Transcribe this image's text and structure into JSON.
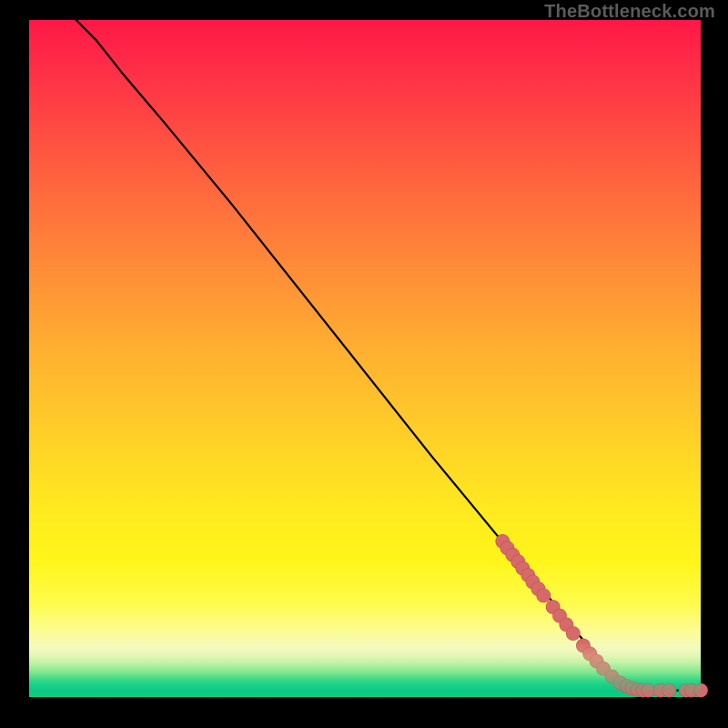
{
  "watermark": "TheBottleneck.com",
  "colors": {
    "marker_fill": "#d66a6a",
    "marker_stroke": "#c25858",
    "line": "#000000",
    "frame": "#000000"
  },
  "chart_data": {
    "type": "line",
    "title": "",
    "xlabel": "",
    "ylabel": "",
    "xlim": [
      0,
      100
    ],
    "ylim": [
      0,
      100
    ],
    "grid": false,
    "legend": false,
    "curve": [
      {
        "x": 7,
        "y": 100
      },
      {
        "x": 8,
        "y": 99
      },
      {
        "x": 10,
        "y": 97
      },
      {
        "x": 12,
        "y": 94.5
      },
      {
        "x": 14,
        "y": 92
      },
      {
        "x": 17,
        "y": 88.5
      },
      {
        "x": 20,
        "y": 85
      },
      {
        "x": 30,
        "y": 73
      },
      {
        "x": 40,
        "y": 60.5
      },
      {
        "x": 50,
        "y": 48
      },
      {
        "x": 60,
        "y": 35.5
      },
      {
        "x": 70,
        "y": 23.5
      },
      {
        "x": 78,
        "y": 14
      },
      {
        "x": 82,
        "y": 9
      },
      {
        "x": 85,
        "y": 5.5
      },
      {
        "x": 87,
        "y": 3.4
      },
      {
        "x": 88.5,
        "y": 2.3
      },
      {
        "x": 90,
        "y": 1.6
      },
      {
        "x": 92,
        "y": 1.2
      },
      {
        "x": 95,
        "y": 1.0
      },
      {
        "x": 98,
        "y": 1.0
      },
      {
        "x": 100,
        "y": 1.0
      }
    ],
    "markers": [
      {
        "x": 70.5,
        "y": 23.0
      },
      {
        "x": 71.2,
        "y": 22.0
      },
      {
        "x": 72.0,
        "y": 21.0
      },
      {
        "x": 72.8,
        "y": 20.0
      },
      {
        "x": 73.5,
        "y": 19.0
      },
      {
        "x": 74.3,
        "y": 18.0
      },
      {
        "x": 75.0,
        "y": 17.0
      },
      {
        "x": 75.8,
        "y": 16.0
      },
      {
        "x": 76.6,
        "y": 15.0
      },
      {
        "x": 78.0,
        "y": 13.3
      },
      {
        "x": 79.0,
        "y": 12.0
      },
      {
        "x": 80.0,
        "y": 10.7
      },
      {
        "x": 81.0,
        "y": 9.4
      },
      {
        "x": 82.5,
        "y": 7.6
      },
      {
        "x": 83.5,
        "y": 6.4
      },
      {
        "x": 84.5,
        "y": 5.3
      },
      {
        "x": 85.5,
        "y": 4.2
      },
      {
        "x": 86.8,
        "y": 3.0
      },
      {
        "x": 88.0,
        "y": 2.1
      },
      {
        "x": 89.0,
        "y": 1.6
      },
      {
        "x": 89.8,
        "y": 1.3
      },
      {
        "x": 90.6,
        "y": 1.1
      },
      {
        "x": 91.4,
        "y": 1.0
      },
      {
        "x": 92.2,
        "y": 1.0
      },
      {
        "x": 94.0,
        "y": 1.0
      },
      {
        "x": 95.3,
        "y": 1.0
      },
      {
        "x": 97.8,
        "y": 1.0
      },
      {
        "x": 98.6,
        "y": 1.0
      },
      {
        "x": 100.0,
        "y": 1.0
      }
    ]
  }
}
